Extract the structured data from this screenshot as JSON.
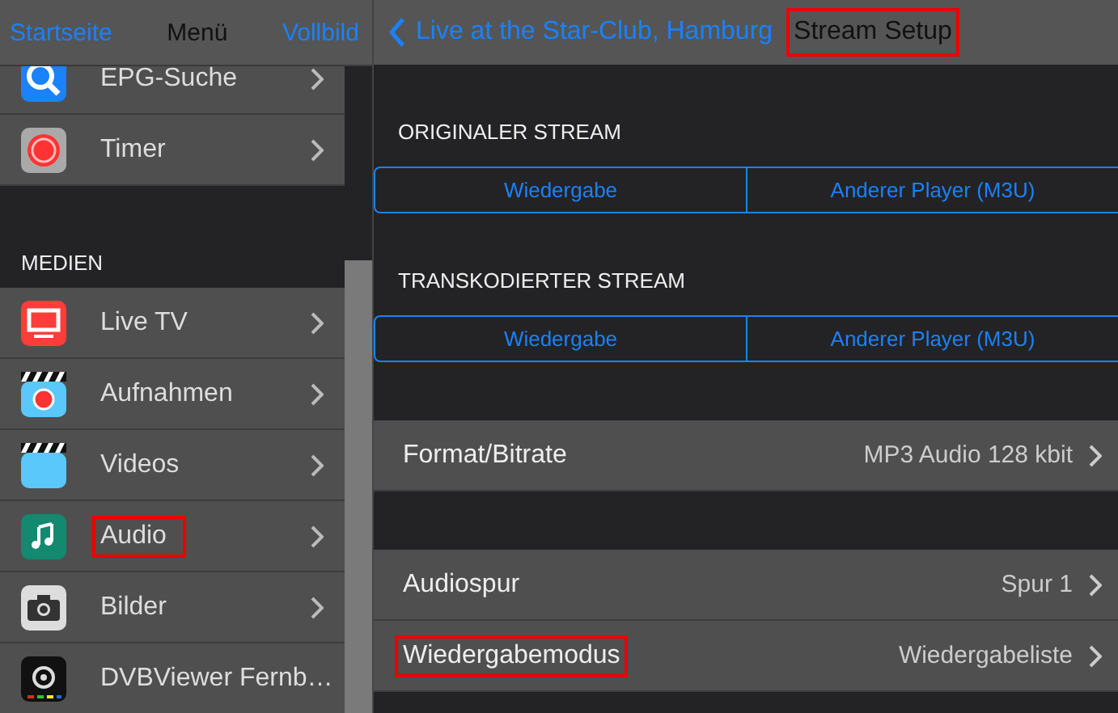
{
  "sidebar": {
    "nav": {
      "left": "Startseite",
      "title": "Menü",
      "right": "Vollbild"
    },
    "groups": [
      {
        "items": [
          {
            "label": "EPG-Suche",
            "kind": "search",
            "highlighted": false,
            "chevron": true
          },
          {
            "label": "Timer",
            "kind": "record",
            "highlighted": false,
            "chevron": true
          }
        ]
      },
      {
        "header": "MEDIEN",
        "items": [
          {
            "label": "Live TV",
            "kind": "tv",
            "highlighted": false,
            "chevron": true
          },
          {
            "label": "Aufnahmen",
            "kind": "recordings",
            "highlighted": false,
            "chevron": true
          },
          {
            "label": "Videos",
            "kind": "videos",
            "highlighted": false,
            "chevron": true
          },
          {
            "label": "Audio",
            "kind": "music",
            "highlighted": true,
            "chevron": true
          },
          {
            "label": "Bilder",
            "kind": "camera",
            "highlighted": false,
            "chevron": true
          },
          {
            "label": "DVBViewer Fernb…",
            "kind": "remote",
            "highlighted": false,
            "chevron": false
          }
        ]
      }
    ]
  },
  "detail": {
    "nav": {
      "back": "Live at the Star-Club, Hamburg",
      "title": "Stream Setup",
      "title_highlighted": true
    },
    "streams": [
      {
        "header": "ORIGINALER STREAM",
        "buttons": [
          "Wiedergabe",
          "Anderer Player (M3U)"
        ]
      },
      {
        "header": "TRANSKODIERTER STREAM",
        "buttons": [
          "Wiedergabe",
          "Anderer Player (M3U)"
        ]
      }
    ],
    "groups": [
      [
        {
          "label": "Format/Bitrate",
          "value": "MP3 Audio 128 kbit",
          "highlighted": false
        }
      ],
      [
        {
          "label": "Audiospur",
          "value": "Spur 1",
          "highlighted": false
        },
        {
          "label": "Wiedergabemodus",
          "value": "Wiedergabeliste",
          "highlighted": true
        }
      ]
    ]
  }
}
